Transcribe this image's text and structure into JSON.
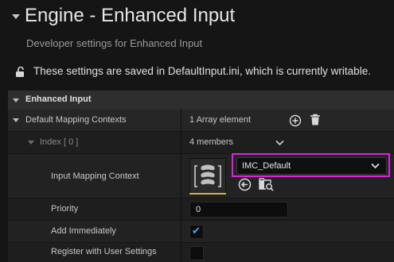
{
  "header": {
    "title": "Engine - Enhanced Input",
    "subtitle": "Developer settings for Enhanced Input",
    "saved_notice": "These settings are saved in DefaultInput.ini, which is currently writable."
  },
  "section": {
    "label": "Enhanced Input"
  },
  "rows": {
    "default_mapping_contexts": {
      "label": "Default Mapping Contexts",
      "value": "1 Array element"
    },
    "index": {
      "label": "Index [ 0 ]",
      "value": "4 members"
    },
    "input_mapping_context": {
      "label": "Input Mapping Context",
      "selected": "IMC_Default"
    },
    "priority": {
      "label": "Priority",
      "value": "0"
    },
    "add_immediately": {
      "label": "Add Immediately",
      "checked": true
    },
    "register_user_settings": {
      "label": "Register with User Settings",
      "checked": false
    }
  },
  "icons": {
    "add": "plus-circle-icon",
    "delete": "trash-icon",
    "lock": "unlocked-lock-icon",
    "browse": "browse-to-asset-icon",
    "find": "find-in-content-browser-icon",
    "asset": "input-mapping-context-asset-icon"
  },
  "colors": {
    "highlight": "#e020e0",
    "checkbox_accent": "#4aa3ff",
    "asset_underline": "#c7b84a"
  }
}
